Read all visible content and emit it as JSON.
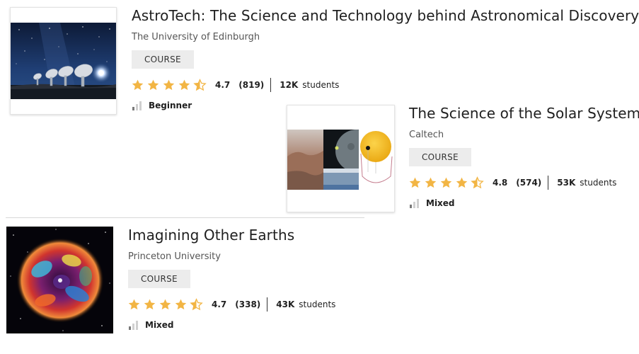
{
  "courses": [
    {
      "title": "AstroTech: The Science and Technology behind Astronomical Discovery",
      "partner": "The University of Edinburgh",
      "type": "COURSE",
      "rating": "4.7",
      "reviews": "(819)",
      "enrollment": "12K",
      "enrollment_label": "students",
      "level": "Beginner",
      "stars": 4.5,
      "level_bars_filled": 1
    },
    {
      "title": "The Science of the Solar System",
      "partner": "Caltech",
      "type": "COURSE",
      "rating": "4.8",
      "reviews": "(574)",
      "enrollment": "53K",
      "enrollment_label": "students",
      "level": "Mixed",
      "stars": 4.5,
      "level_bars_filled": 1
    },
    {
      "title": "Imagining Other Earths",
      "partner": "Princeton University",
      "type": "COURSE",
      "rating": "4.7",
      "reviews": "(338)",
      "enrollment": "43K",
      "enrollment_label": "students",
      "level": "Mixed",
      "stars": 4.5,
      "level_bars_filled": 1
    }
  ],
  "colors": {
    "star": "#f2b544",
    "star_empty": "#ffffff",
    "level_filled": "#7a7a7a",
    "level_empty": "#d0d0d0",
    "badge_bg": "#ececec"
  },
  "icons": {
    "rating": "star-icon",
    "level": "level-bars-icon"
  }
}
